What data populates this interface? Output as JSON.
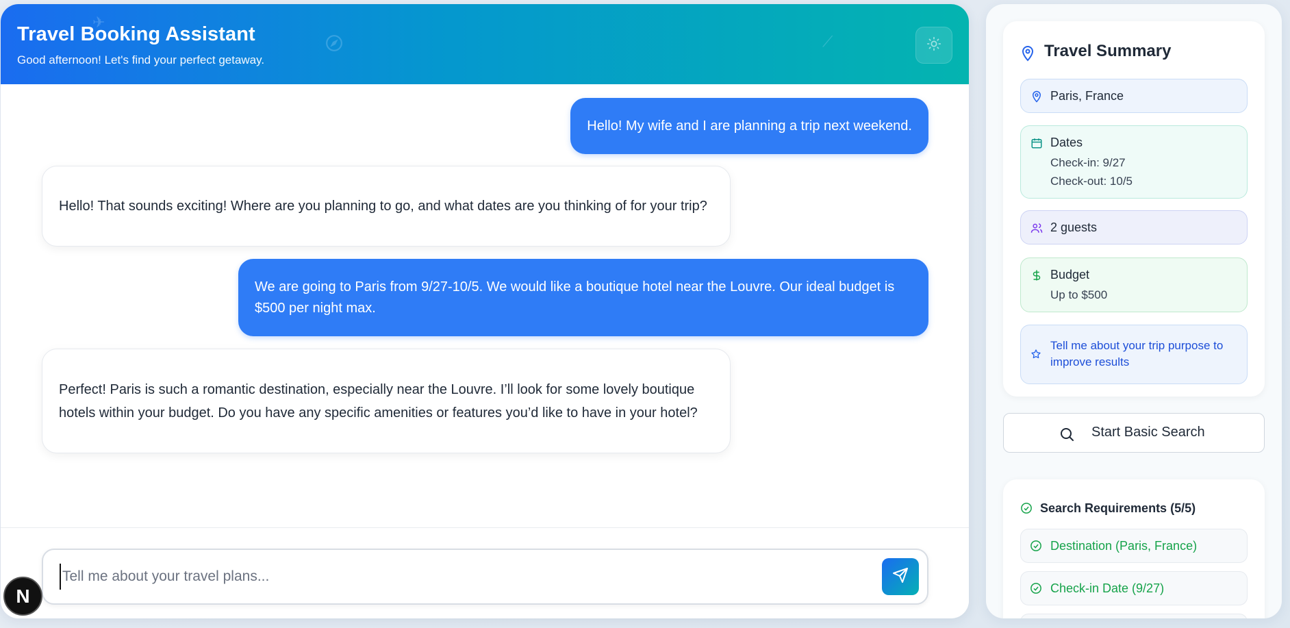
{
  "header": {
    "title": "Travel Booking Assistant",
    "subtitle": "Good afternoon! Let's find your perfect getaway.",
    "theme_icon": "sun-icon"
  },
  "messages": [
    {
      "role": "user",
      "text": "Hello! My wife and I are planning a trip next weekend."
    },
    {
      "role": "assistant",
      "text": "Hello! That sounds exciting! Where are you planning to go, and what dates are you thinking of for your trip?"
    },
    {
      "role": "user",
      "text": "We are going to Paris from 9/27-10/5. We would like a boutique hotel near the Louvre. Our ideal budget is $500 per night max."
    },
    {
      "role": "assistant",
      "text": "Perfect! Paris is such a romantic destination, especially near the Louvre. I’ll look for some lovely boutique hotels within your budget. Do you have any specific amenities or features you’d like to have in your hotel?"
    }
  ],
  "composer": {
    "value": "",
    "placeholder": "Tell me about your travel plans...",
    "send_icon": "send-icon"
  },
  "badge": {
    "label": "N"
  },
  "summary": {
    "title": "Travel Summary",
    "destination": "Paris, France",
    "dates_label": "Dates",
    "checkin": "Check-in: 9/27",
    "checkout": "Check-out: 10/5",
    "guests": "2 guests",
    "budget_label": "Budget",
    "budget_value": "Up to $500",
    "purpose_prompt": "Tell me about your trip purpose to improve results"
  },
  "search_button": {
    "label": "Start Basic Search"
  },
  "requirements": {
    "title": "Search Requirements (5/5)",
    "items": [
      {
        "label": "Destination (Paris, France)"
      },
      {
        "label": "Check-in Date (9/27)"
      }
    ]
  },
  "colors": {
    "brand_blue": "#2f7cf6",
    "gradient_start": "#1a6cf0",
    "gradient_end": "#04b4b0",
    "success_green": "#16a34a"
  }
}
